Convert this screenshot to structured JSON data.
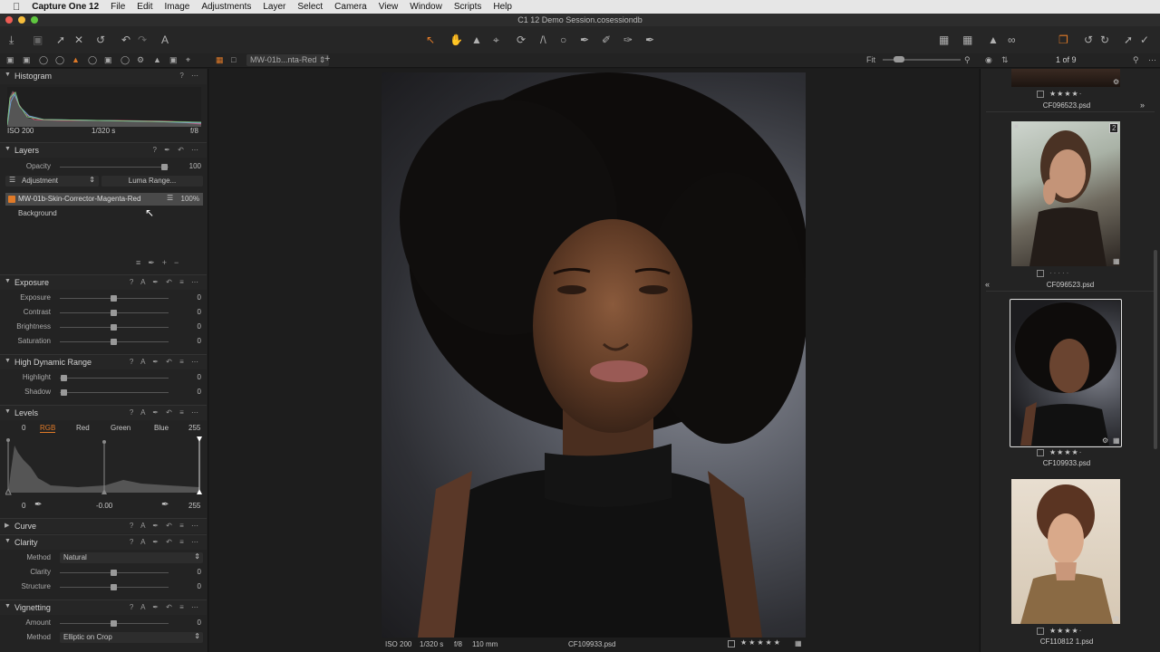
{
  "menubar": {
    "apple": "",
    "app": "Capture One 12",
    "items": [
      "File",
      "Edit",
      "Image",
      "Adjustments",
      "Layer",
      "Select",
      "Camera",
      "View",
      "Window",
      "Scripts",
      "Help"
    ]
  },
  "window": {
    "title": "C1 12 Demo Session.cosessiondb"
  },
  "tabbar": {
    "variant_tab": "MW-01b...nta-Red",
    "fit_label": "Fit"
  },
  "browser": {
    "counter": "1 of 9"
  },
  "histogram": {
    "title": "Histogram",
    "iso": "ISO 200",
    "shutter": "1/320 s",
    "aperture": "f/8"
  },
  "layers": {
    "title": "Layers",
    "opacity_label": "Opacity",
    "opacity_value": "100",
    "adjustment_label": "Adjustment",
    "luma_button": "Luma Range...",
    "selected_layer": "MW-01b-Skin-Corrector-Magenta-Red",
    "selected_opacity": "100%",
    "background_layer": "Background"
  },
  "exposure": {
    "title": "Exposure",
    "rows": [
      {
        "label": "Exposure",
        "value": "0"
      },
      {
        "label": "Contrast",
        "value": "0"
      },
      {
        "label": "Brightness",
        "value": "0"
      },
      {
        "label": "Saturation",
        "value": "0"
      }
    ]
  },
  "hdr": {
    "title": "High Dynamic Range",
    "rows": [
      {
        "label": "Highlight",
        "value": "0"
      },
      {
        "label": "Shadow",
        "value": "0"
      }
    ]
  },
  "levels": {
    "title": "Levels",
    "min": "0",
    "max": "255",
    "channels": [
      "RGB",
      "Red",
      "Green",
      "Blue"
    ],
    "out_min": "0",
    "mid": "-0.00",
    "out_max": "255"
  },
  "curve": {
    "title": "Curve"
  },
  "clarity": {
    "title": "Clarity",
    "method_label": "Method",
    "method_value": "Natural",
    "rows": [
      {
        "label": "Clarity",
        "value": "0"
      },
      {
        "label": "Structure",
        "value": "0"
      }
    ]
  },
  "vignetting": {
    "title": "Vignetting",
    "amount_label": "Amount",
    "amount_value": "0",
    "method_label": "Method",
    "method_value": "Elliptic on Crop"
  },
  "viewer_status": {
    "iso": "ISO 200",
    "shutter": "1/320 s",
    "aperture": "f/8",
    "focal": "110 mm",
    "filename": "CF109933.psd"
  },
  "thumbnails": [
    {
      "filename": "CF096523.psd",
      "badge": ""
    },
    {
      "filename": "CF096523.psd",
      "badge": "2"
    },
    {
      "filename": "CF109933.psd",
      "badge": ""
    },
    {
      "filename": "CF110812 1.psd",
      "badge": ""
    }
  ],
  "colors": {
    "accent": "#e07a28",
    "panel": "#232323",
    "selected_border": "#e0e0e0"
  }
}
